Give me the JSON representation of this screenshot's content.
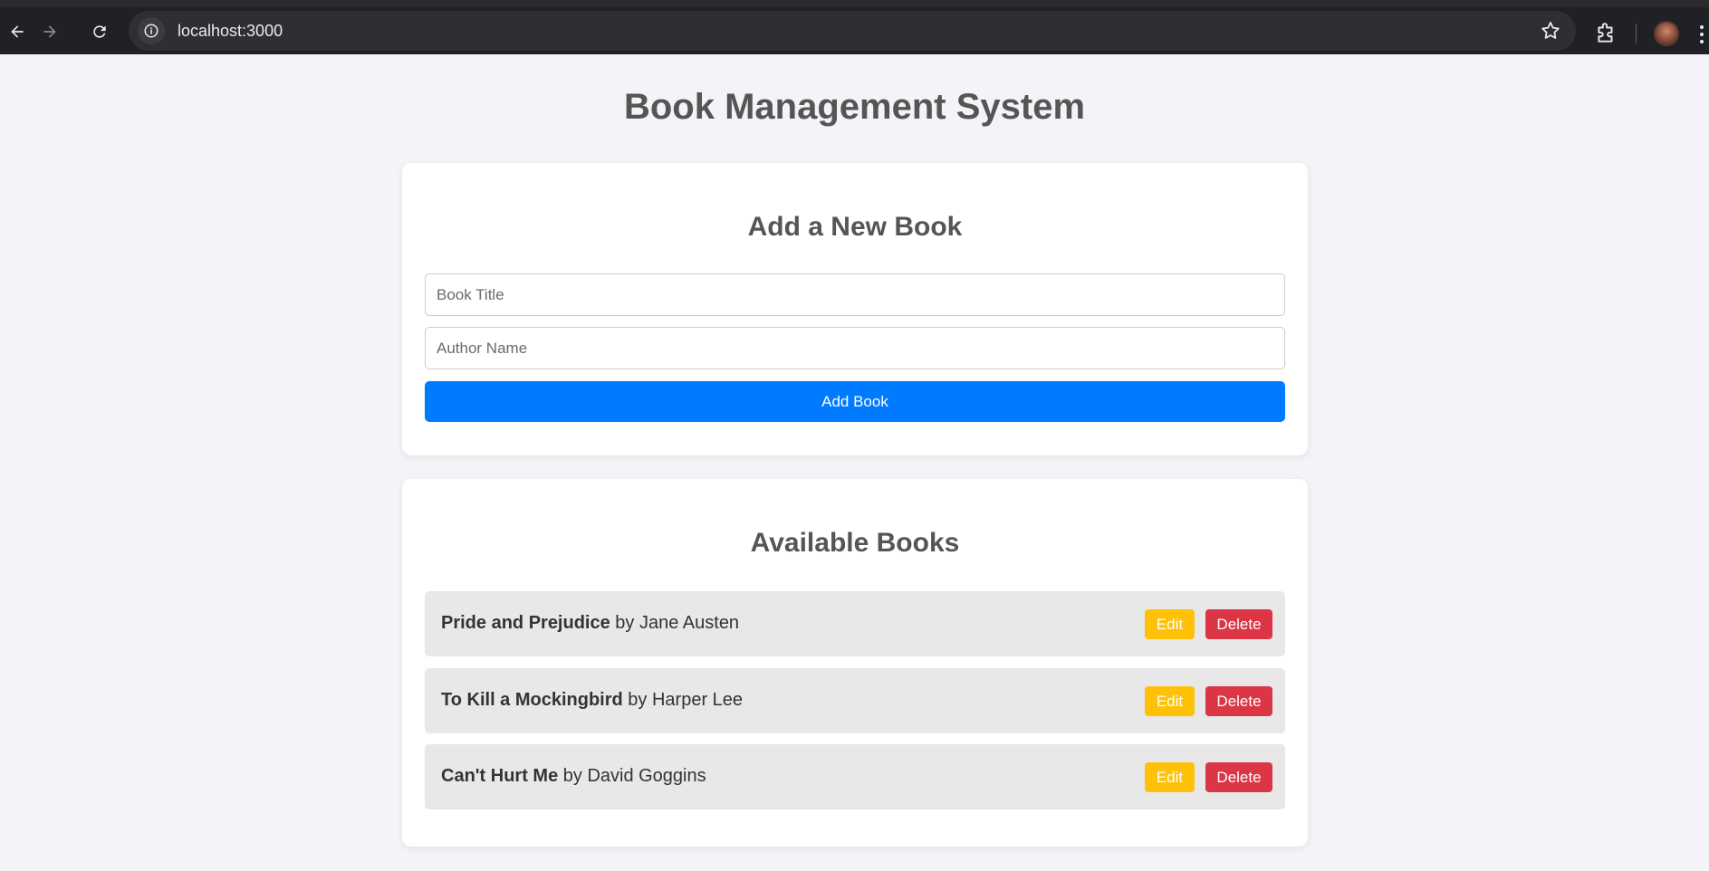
{
  "browser": {
    "url": "localhost:3000"
  },
  "page": {
    "title": "Book Management System"
  },
  "add_form": {
    "heading": "Add a New Book",
    "title_placeholder": "Book Title",
    "title_value": "",
    "author_placeholder": "Author Name",
    "author_value": "",
    "submit_label": "Add Book"
  },
  "book_list": {
    "heading": "Available Books",
    "books": [
      {
        "title": "Pride and Prejudice",
        "byline": " by Jane Austen",
        "edit_label": "Edit",
        "delete_label": "Delete"
      },
      {
        "title": "To Kill a Mockingbird",
        "byline": " by Harper Lee",
        "edit_label": "Edit",
        "delete_label": "Delete"
      },
      {
        "title": "Can't Hurt Me",
        "byline": " by David Goggins",
        "edit_label": "Edit",
        "delete_label": "Delete"
      }
    ]
  },
  "colors": {
    "primary": "#007bff",
    "edit": "#ffc107",
    "delete": "#dc3545",
    "background": "#f4f4f8"
  }
}
